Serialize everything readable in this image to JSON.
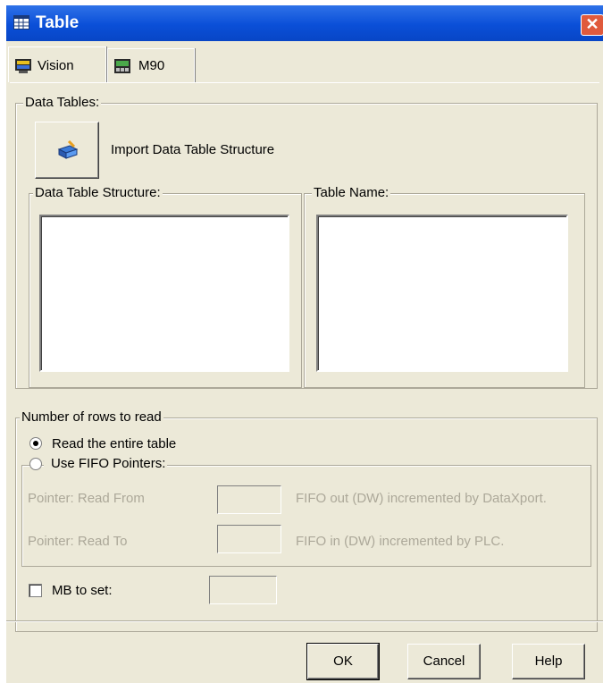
{
  "window": {
    "title": "Table",
    "close_glyph": "✕"
  },
  "tabs": [
    {
      "label": "Vision",
      "icon": "monitor-icon",
      "active": true
    },
    {
      "label": "M90",
      "icon": "plc-icon",
      "active": false
    }
  ],
  "data_tables": {
    "group_label": "Data Tables:",
    "import_button_icon": "import-icon",
    "import_label": "Import Data Table Structure",
    "structure_label": "Data Table Structure:",
    "table_name_label": "Table Name:"
  },
  "rows": {
    "group_label": "Number of rows to read",
    "read_entire": {
      "label": "Read the entire table",
      "selected": true
    },
    "use_fifo": {
      "label": "Use FIFO Pointers:",
      "selected": false
    },
    "pointer_from": {
      "label": "Pointer: Read From",
      "value": "",
      "desc": "FIFO out (DW) incremented by DataXport."
    },
    "pointer_to": {
      "label": "Pointer: Read To",
      "value": "",
      "desc": "FIFO in (DW) incremented by PLC."
    }
  },
  "mb": {
    "label": "MB to set:",
    "value": "",
    "checked": false
  },
  "buttons": {
    "ok": "OK",
    "cancel": "Cancel",
    "help": "Help"
  },
  "colors": {
    "titlebar": "#0a4fd8",
    "dialog_bg": "#ece9d8",
    "disabled_text": "#aca899"
  }
}
